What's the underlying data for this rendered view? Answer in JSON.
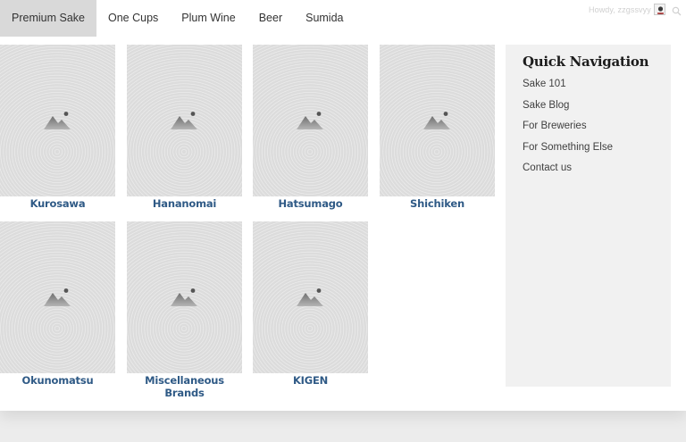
{
  "nav": {
    "items": [
      {
        "label": "Premium Sake",
        "active": true
      },
      {
        "label": "One Cups",
        "active": false
      },
      {
        "label": "Plum Wine",
        "active": false
      },
      {
        "label": "Beer",
        "active": false
      },
      {
        "label": "Sumida",
        "active": false
      }
    ]
  },
  "user": {
    "greeting": "Howdy, zzgssvyy",
    "avatar_icon": "avatar",
    "search_icon": "search-icon"
  },
  "brands": [
    {
      "label": "Kurosawa"
    },
    {
      "label": "Hananomai"
    },
    {
      "label": "Hatsumago"
    },
    {
      "label": "Shichiken"
    },
    {
      "label": "Okunomatsu"
    },
    {
      "label": "Miscellaneous Brands"
    },
    {
      "label": "KIGEN"
    }
  ],
  "sidebar": {
    "title": "Quick Navigation",
    "links": [
      {
        "label": "Sake 101"
      },
      {
        "label": "Sake Blog"
      },
      {
        "label": "For Breweries"
      },
      {
        "label": "For Something Else"
      },
      {
        "label": "Contact us"
      }
    ]
  },
  "colors": {
    "link": "#2f5a86",
    "nav_active_bg": "#d9d9d9",
    "sidebar_bg": "#f1f1f1",
    "thumb_bg": "#dcdcdc"
  }
}
